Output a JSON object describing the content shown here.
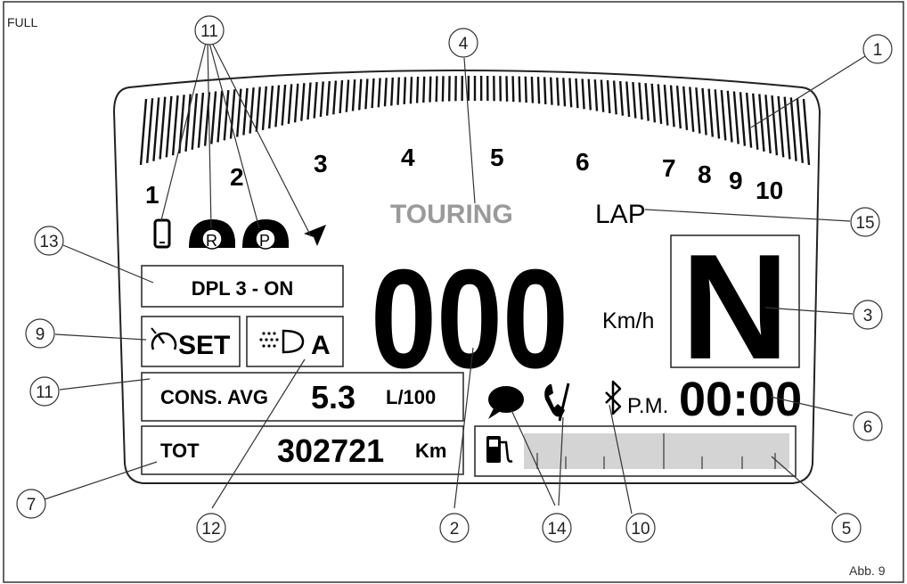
{
  "header": {
    "mode_label": "FULL"
  },
  "footer": {
    "figure_ref": "Abb. 9"
  },
  "tachometer": {
    "scale_labels": [
      "1",
      "2",
      "3",
      "4",
      "5",
      "6",
      "7",
      "8",
      "9",
      "10"
    ]
  },
  "riding_mode": "TOURING",
  "lap": "LAP",
  "speed": {
    "value": "000",
    "unit": "Km/h"
  },
  "gear": "N",
  "dpl": "DPL 3 - ON",
  "cruise_control": "SET",
  "headlight_mode": "A",
  "consumption": {
    "label": "CONS. AVG",
    "value": "5.3",
    "unit": "L/100"
  },
  "odometer": {
    "label": "TOT",
    "value": "302721",
    "unit": "Km"
  },
  "clock": {
    "ampm": "P.M.",
    "time": "00:00"
  },
  "fuel_gauge": {
    "fill_fraction": 0
  },
  "icons": {
    "phone": "smartphone-icon",
    "helmet_rider": "helmet-rider-icon",
    "helmet_rider_label": "R",
    "helmet_passenger": "helmet-passenger-icon",
    "helmet_passenger_label": "P",
    "navigation": "navigation-arrow-icon",
    "cruise": "cruise-control-icon",
    "headlight": "headlight-icon",
    "message": "message-icon",
    "missed_call": "missed-call-icon",
    "bluetooth": "bluetooth-icon",
    "fuel": "fuel-pump-icon"
  },
  "callouts": [
    "1",
    "2",
    "3",
    "4",
    "5",
    "6",
    "7",
    "9",
    "10",
    "11",
    "11",
    "12",
    "13",
    "14",
    "15"
  ],
  "colors": {
    "stroke": "#222222",
    "mode_gray": "#9a9a9a",
    "fuel_bar": "#d4d4d4",
    "background": "#ffffff"
  }
}
